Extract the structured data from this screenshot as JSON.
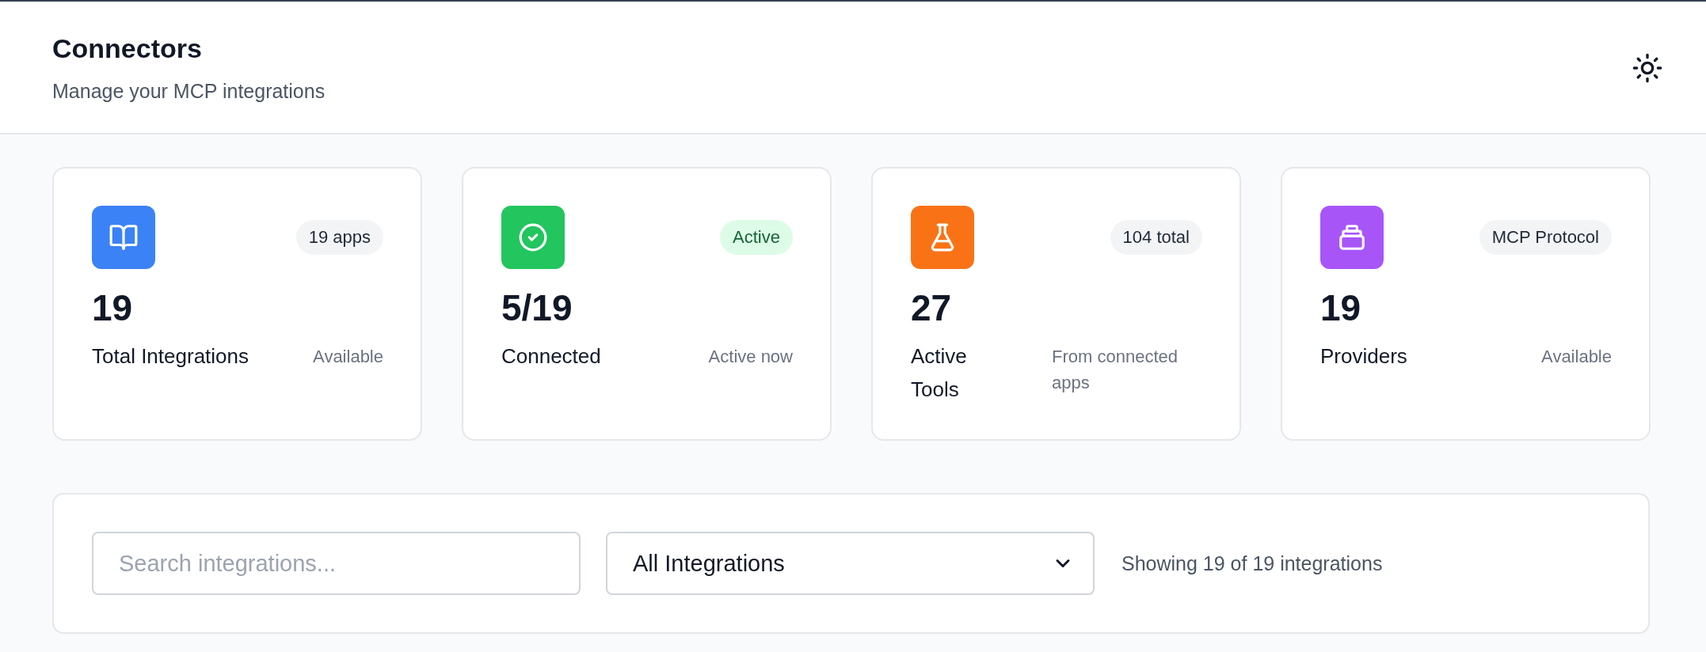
{
  "header": {
    "title": "Connectors",
    "subtitle": "Manage your MCP integrations"
  },
  "stats": [
    {
      "color": "#3b82f6",
      "badge": "19 apps",
      "badge_active": false,
      "value": "19",
      "label": "Total Integrations",
      "note": "Available"
    },
    {
      "color": "#22c55e",
      "badge": "Active",
      "badge_active": true,
      "value": "5/19",
      "label": "Connected",
      "note": "Active now"
    },
    {
      "color": "#f97316",
      "badge": "104 total",
      "badge_active": false,
      "value": "27",
      "label": "Active Tools",
      "note": "From connected apps"
    },
    {
      "color": "#a855f7",
      "badge": "MCP Protocol",
      "badge_active": false,
      "value": "19",
      "label": "Providers",
      "note": "Available"
    }
  ],
  "filters": {
    "search": {
      "placeholder": "Search integrations..."
    },
    "category": {
      "value": "All Integrations"
    },
    "summary": "Showing 19 of 19 integrations"
  }
}
